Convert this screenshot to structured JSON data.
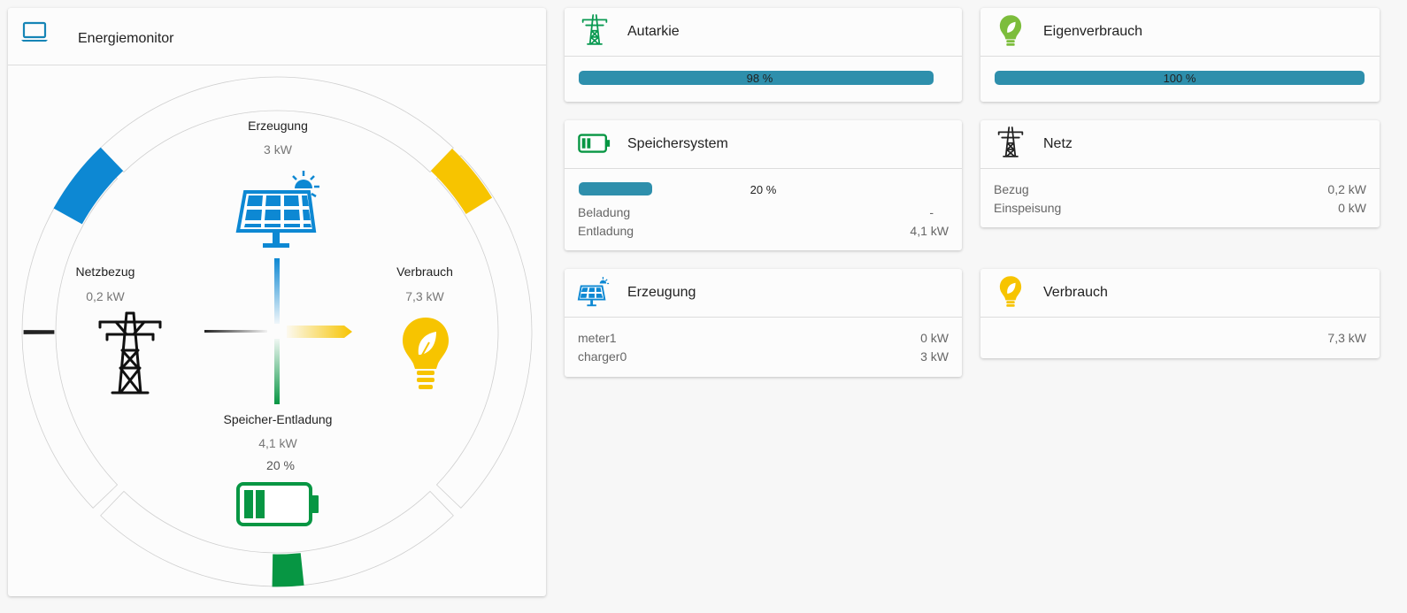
{
  "monitor": {
    "title": "Energiemonitor",
    "icon": "laptop-icon",
    "production": {
      "label": "Erzeugung",
      "value": "3 kW",
      "icon": "solar-panel-icon"
    },
    "grid": {
      "label": "Netzbezug",
      "value": "0,2 kW",
      "icon": "power-tower-icon"
    },
    "consumption": {
      "label": "Verbrauch",
      "value": "7,3 kW",
      "icon": "eco-bulb-icon"
    },
    "storage": {
      "label": "Speicher-Entladung",
      "value": "4,1 kW",
      "soc": "20 %",
      "soc_fraction": 0.2,
      "icon": "battery-icon"
    },
    "colors": {
      "production": "#0d88d3",
      "consumption": "#f7c400",
      "storage": "#079643",
      "grid": "#222222"
    }
  },
  "autarkie": {
    "title": "Autarkie",
    "icon": "power-tower-icon",
    "percent_text": "98 %",
    "fraction": 0.98
  },
  "eigenverbrauch": {
    "title": "Eigenverbrauch",
    "icon": "bulb-icon",
    "percent_text": "100 %",
    "fraction": 1.0
  },
  "speicher": {
    "title": "Speichersystem",
    "icon": "battery-icon",
    "soc_text": "20 %",
    "fraction": 0.2,
    "rows": [
      {
        "label": "Beladung",
        "value": "-"
      },
      {
        "label": "Entladung",
        "value": "4,1 kW"
      }
    ]
  },
  "netz": {
    "title": "Netz",
    "icon": "power-tower-icon",
    "rows": [
      {
        "label": "Bezug",
        "value": "0,2 kW"
      },
      {
        "label": "Einspeisung",
        "value": "0 kW"
      }
    ]
  },
  "erzeugung": {
    "title": "Erzeugung",
    "icon": "solar-panel-icon",
    "rows": [
      {
        "label": "meter1",
        "value": "0 kW"
      },
      {
        "label": "charger0",
        "value": "3 kW"
      }
    ]
  },
  "verbrauch": {
    "title": "Verbrauch",
    "icon": "bulb-icon",
    "value": "7,3 kW"
  },
  "colors": {
    "bar": "#2e8fac",
    "bar_track": "#2e8fac"
  }
}
